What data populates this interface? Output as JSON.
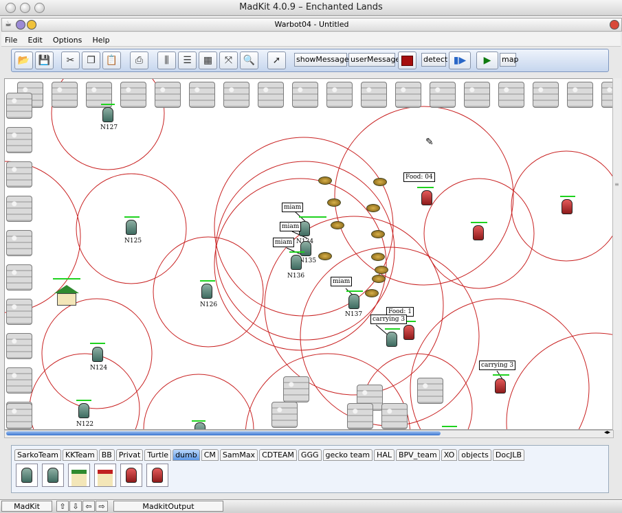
{
  "window": {
    "title": "MadKit 4.0.9 – Enchanted Lands",
    "doc_title": "Warbot04 - Untitled"
  },
  "menu": [
    "File",
    "Edit",
    "Options",
    "Help"
  ],
  "toolbar": {
    "show_messages": "showMessages",
    "user_message": "userMessage",
    "detect": "detect",
    "map": "map"
  },
  "agents": {
    "n127": "N127",
    "n125": "N125",
    "n126": "N126",
    "n124": "N124",
    "n122": "N122",
    "n136": "N136",
    "n137": "N137",
    "n134": "N134",
    "n135": "N135"
  },
  "bubbles": {
    "miam1": "miam",
    "miam2": "miam",
    "miam3": "miam",
    "miam4": "miam",
    "food04": "Food: 04",
    "food1": "Food: 1",
    "carrying1": "carrying 3",
    "carrying2": "carrying 3"
  },
  "palette_tabs": [
    "SarkoTeam",
    "KKTeam",
    "BB",
    "Privat",
    "Turtle",
    "dumb",
    "CM",
    "SamMax",
    "CDTEAM",
    "GGG",
    "gecko team",
    "HAL",
    "BPV_team",
    "XO",
    "objects",
    "DocJLB"
  ],
  "selected_tab": "dumb",
  "status": {
    "madkit": "MadKit",
    "output": "MadkitOutput"
  },
  "colors": {
    "team_green": "#3e6b60",
    "team_red": "#b22222",
    "radar": "#c82020",
    "health": "#1dd21d",
    "tab_selected": "#5f9ae8"
  }
}
